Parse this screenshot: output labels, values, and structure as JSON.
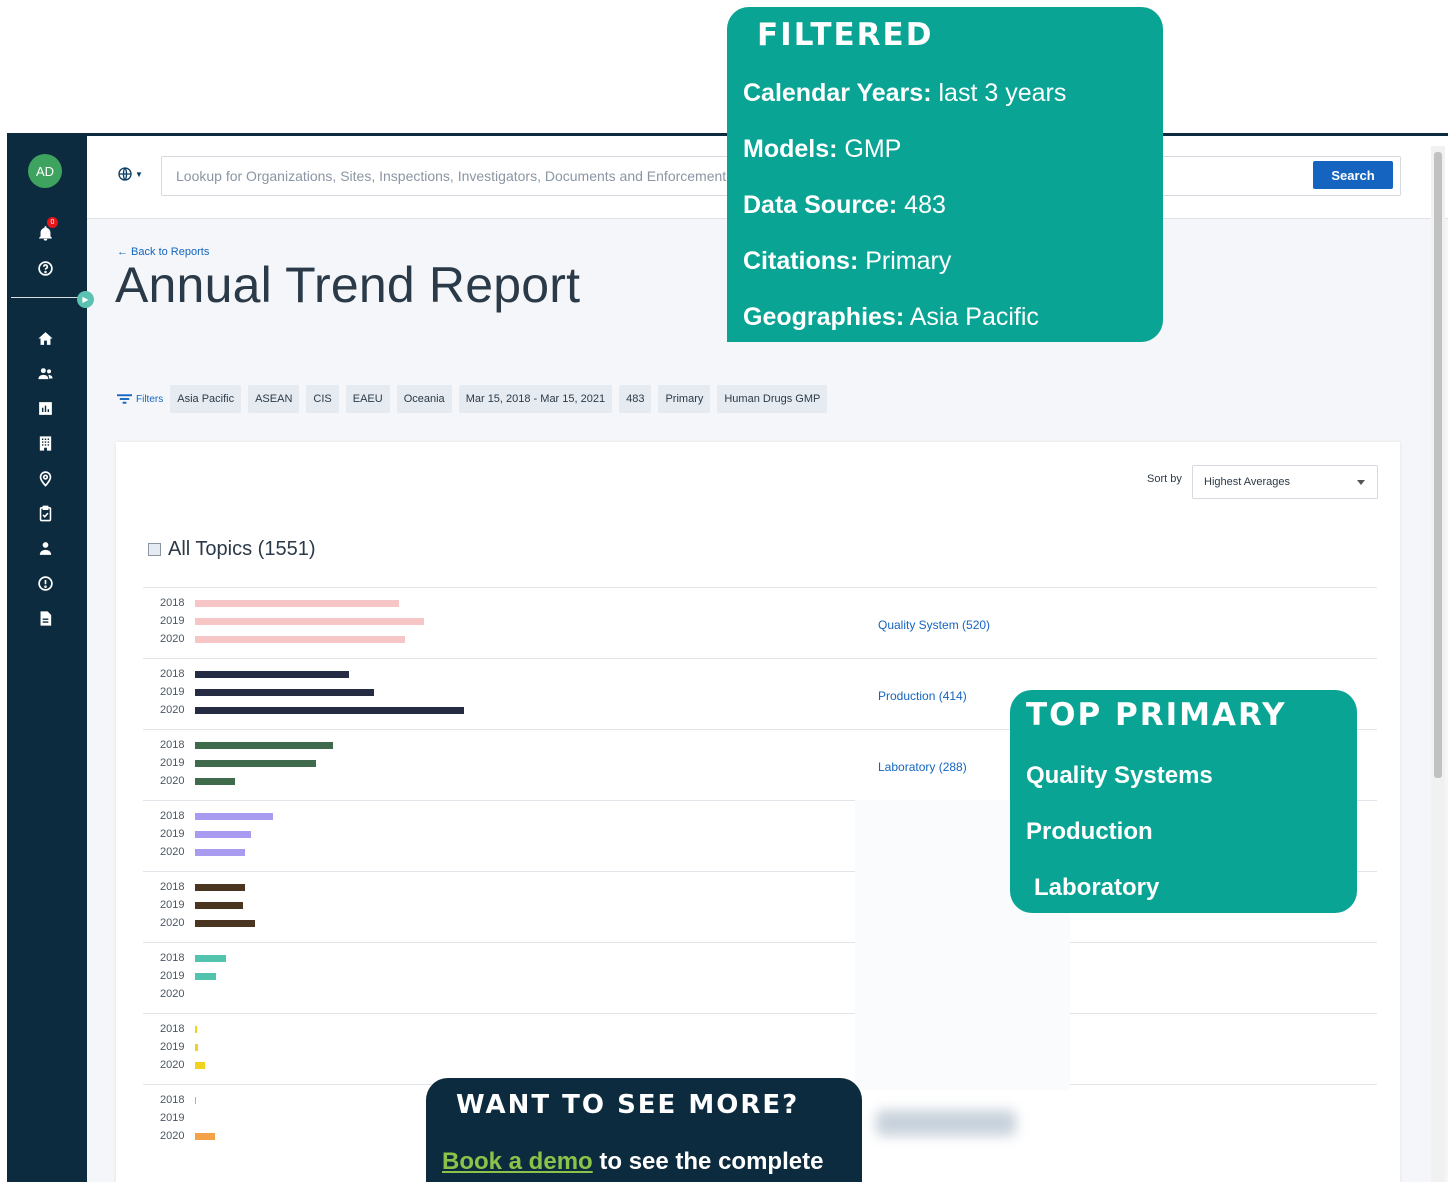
{
  "app": {
    "avatar_initials": "AD",
    "notification_count": "0",
    "search_placeholder": "Lookup for Organizations, Sites, Inspections, Investigators, Documents and Enforcement",
    "search_button": "Search"
  },
  "sidebar": {
    "icons": [
      "bell-icon",
      "help-icon",
      "home-icon",
      "users-icon",
      "report-icon",
      "building-icon",
      "location-icon",
      "clipboard-icon",
      "person-icon",
      "alert-icon",
      "document-icon"
    ]
  },
  "report": {
    "back_link": "← Back to Reports",
    "title": "Annual Trend Report",
    "filters_label": "Filters",
    "filter_chips": [
      "Asia Pacific",
      "ASEAN",
      "CIS",
      "EAEU",
      "Oceania",
      "Mar 15, 2018 - Mar 15, 2021",
      "483",
      "Primary",
      "Human Drugs GMP"
    ],
    "sort_label": "Sort by",
    "sort_value": "Highest Averages",
    "all_topics_label": "All Topics (1551)"
  },
  "chart_data": {
    "type": "bar",
    "years": [
      "2018",
      "2019",
      "2020"
    ],
    "groups": [
      {
        "label": "Quality System (520)",
        "color": "#f6c6c6",
        "values": [
          204,
          229,
          210
        ]
      },
      {
        "label": "Production (414)",
        "color": "#262b44",
        "values": [
          154,
          179,
          269
        ]
      },
      {
        "label": "Laboratory (288)",
        "color": "#3f6a4b",
        "values": [
          138,
          121,
          40
        ]
      },
      {
        "label": "",
        "color": "#a99bf0",
        "values": [
          78,
          56,
          50
        ]
      },
      {
        "label": "",
        "color": "#4a3520",
        "values": [
          50,
          48,
          60
        ]
      },
      {
        "label": "",
        "color": "#52c4ae",
        "values": [
          31,
          21,
          0
        ]
      },
      {
        "label": "",
        "color": "#f1d21c",
        "values": [
          2,
          3,
          10
        ]
      },
      {
        "label": "",
        "color": "#f4a24a",
        "values": [
          1,
          0,
          20
        ]
      }
    ]
  },
  "overlays": {
    "filtered": {
      "heading": "FILTERED",
      "lines": [
        {
          "key": "Calendar Years:",
          "value": " last 3 years"
        },
        {
          "key": "Models:",
          "value": " GMP"
        },
        {
          "key": "Data Source:",
          "value": " 483"
        },
        {
          "key": "Citations:",
          "value": " Primary"
        },
        {
          "key": "Geographies:",
          "value": " Asia Pacific"
        }
      ]
    },
    "top_primary": {
      "heading": "TOP PRIMARY",
      "items": [
        "Quality Systems",
        "Production",
        "Laboratory"
      ]
    },
    "demo": {
      "heading": "WANT TO SEE MORE?",
      "link": "Book a demo",
      "text": " to see the complete"
    }
  },
  "colors": {
    "sidebar": "#0d2b3e",
    "accent_teal": "#0aa495",
    "link_blue": "#1565c0",
    "demo_link_green": "#8bc34a"
  }
}
